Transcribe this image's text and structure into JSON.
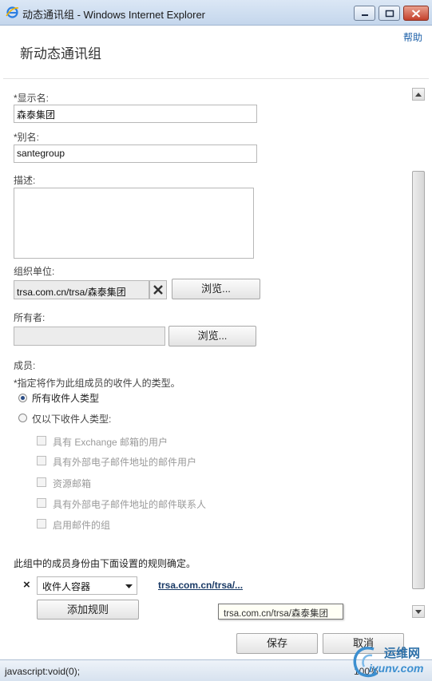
{
  "window": {
    "title": "动态通讯组 - Windows Internet Explorer",
    "icon": "ie-icon"
  },
  "header": {
    "help": "帮助",
    "title": "新动态通讯组"
  },
  "form": {
    "display_name": {
      "label": "*显示名:",
      "value": "森泰集团"
    },
    "alias": {
      "label": "*别名:",
      "value": "santegroup"
    },
    "description": {
      "label": "描述:",
      "value": ""
    },
    "org_unit": {
      "label": "组织单位:",
      "value": "trsa.com.cn/trsa/森泰集团",
      "browse": "浏览..."
    },
    "owner": {
      "label": "所有者:",
      "value": "",
      "browse": "浏览..."
    },
    "members": {
      "label": "成员:",
      "instruction": "*指定将作为此组成员的收件人的类型。",
      "radio_all": {
        "label": "所有收件人类型",
        "selected": true
      },
      "radio_only": {
        "label": "仅以下收件人类型:",
        "selected": false
      },
      "checkboxes": [
        {
          "label": "具有 Exchange 邮箱的用户",
          "checked": false
        },
        {
          "label": "具有外部电子邮件地址的邮件用户",
          "checked": false
        },
        {
          "label": "资源邮箱",
          "checked": false
        },
        {
          "label": "具有外部电子邮件地址的邮件联系人",
          "checked": false
        },
        {
          "label": "启用邮件的组",
          "checked": false
        }
      ]
    },
    "rules": {
      "note": "此组中的成员身份由下面设置的规则确定。",
      "remove": "×",
      "condition": "收件人容器",
      "value_link": "trsa.com.cn/trsa/...",
      "add_rule": "添加规则",
      "tooltip": "trsa.com.cn/trsa/森泰集团"
    }
  },
  "footer": {
    "save": "保存",
    "cancel": "取消"
  },
  "statusbar": {
    "text": "javascript:void(0);",
    "zoom": "100%"
  },
  "watermark": {
    "top": "运维网",
    "bottom": "iyunv.com"
  },
  "colors": {
    "accent_link": "#1b5fa8",
    "titlebar": "#c4d6ec",
    "close_button": "#c4412c"
  }
}
